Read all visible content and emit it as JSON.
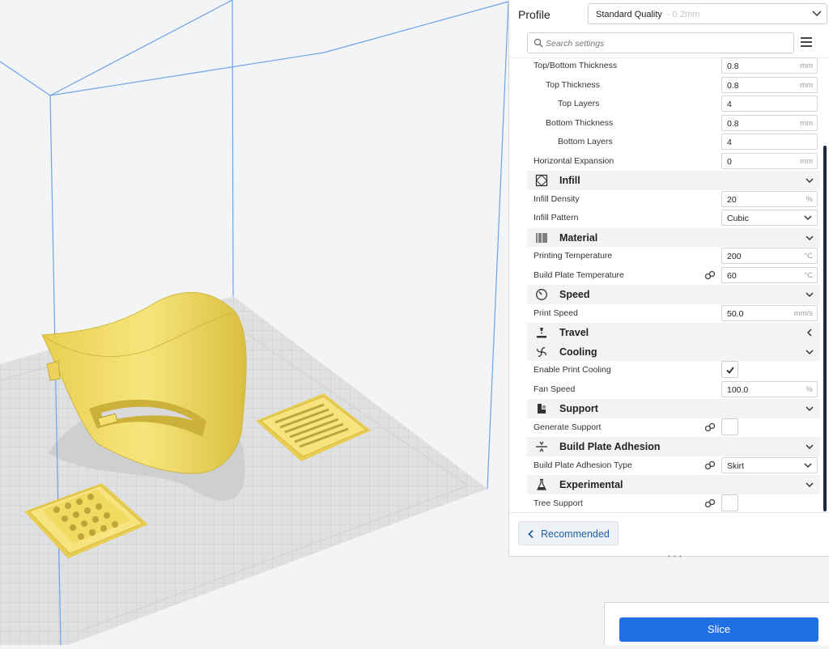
{
  "profile": {
    "label": "Profile",
    "value": "Standard Quality",
    "sub": "- 0.2mm"
  },
  "search": {
    "placeholder": "Search settings"
  },
  "settings": {
    "top_bottom_thickness": {
      "label": "Top/Bottom Thickness",
      "value": "0.8",
      "unit": "mm"
    },
    "top_thickness": {
      "label": "Top Thickness",
      "value": "0.8",
      "unit": "mm"
    },
    "top_layers": {
      "label": "Top Layers",
      "value": "4"
    },
    "bottom_thickness": {
      "label": "Bottom Thickness",
      "value": "0.8",
      "unit": "mm"
    },
    "bottom_layers": {
      "label": "Bottom Layers",
      "value": "4"
    },
    "horizontal_expansion": {
      "label": "Horizontal Expansion",
      "value": "0",
      "unit": "mm"
    },
    "infill_category": "Infill",
    "infill_density": {
      "label": "Infill Density",
      "value": "20",
      "unit": "%"
    },
    "infill_pattern": {
      "label": "Infill Pattern",
      "value": "Cubic"
    },
    "material_category": "Material",
    "printing_temperature": {
      "label": "Printing Temperature",
      "value": "200",
      "unit": "°C"
    },
    "build_plate_temperature": {
      "label": "Build Plate Temperature",
      "value": "60",
      "unit": "°C"
    },
    "speed_category": "Speed",
    "print_speed": {
      "label": "Print Speed",
      "value": "50.0",
      "unit": "mm/s"
    },
    "travel_category": "Travel",
    "cooling_category": "Cooling",
    "enable_print_cooling": {
      "label": "Enable Print Cooling",
      "checked": true
    },
    "fan_speed": {
      "label": "Fan Speed",
      "value": "100.0",
      "unit": "%"
    },
    "support_category": "Support",
    "generate_support": {
      "label": "Generate Support",
      "checked": false
    },
    "adhesion_category": "Build Plate Adhesion",
    "adhesion_type": {
      "label": "Build Plate Adhesion Type",
      "value": "Skirt"
    },
    "experimental_category": "Experimental",
    "tree_support": {
      "label": "Tree Support",
      "checked": false
    }
  },
  "footer": {
    "recommended_label": "Recommended",
    "grip": "• • •"
  },
  "slice": {
    "label": "Slice"
  },
  "colors": {
    "accent": "#1f6fe5",
    "model": "#f4e071",
    "build_volume": "#6ea3e8"
  }
}
